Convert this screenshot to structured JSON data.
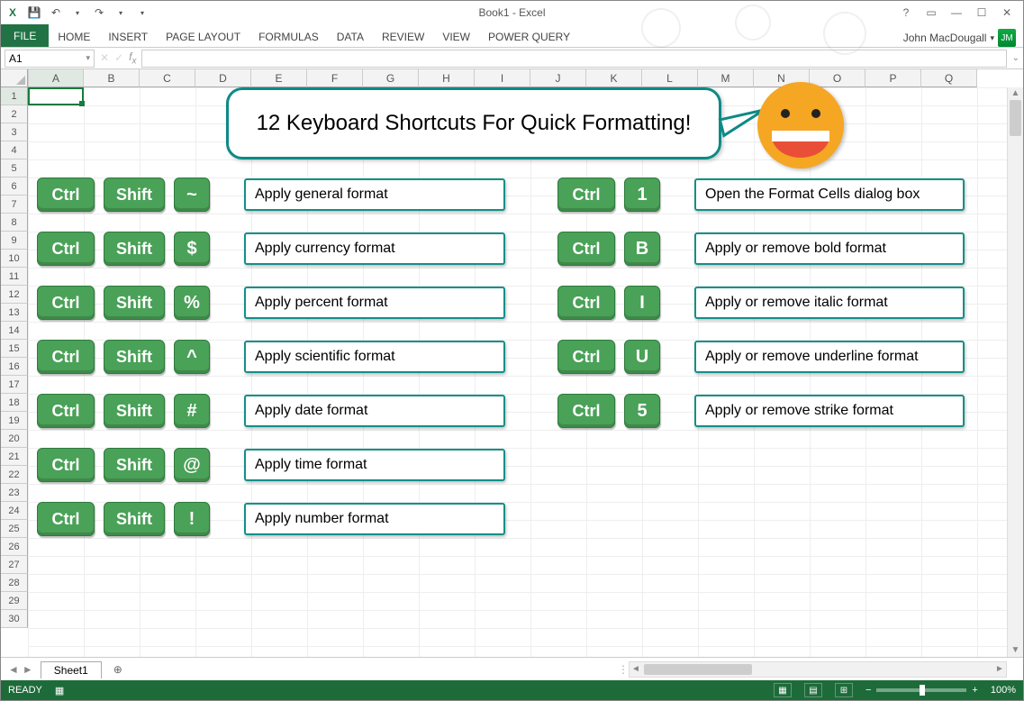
{
  "title": "Book1 - Excel",
  "user": "John MacDougall",
  "ribbon": {
    "file": "FILE",
    "tabs": [
      "HOME",
      "INSERT",
      "PAGE LAYOUT",
      "FORMULAS",
      "DATA",
      "REVIEW",
      "VIEW",
      "POWER QUERY"
    ]
  },
  "namebox": "A1",
  "callout": "12 Keyboard Shortcuts For Quick Formatting!",
  "columns": [
    "A",
    "B",
    "C",
    "D",
    "E",
    "F",
    "G",
    "H",
    "I",
    "J",
    "K",
    "L",
    "M",
    "N",
    "O",
    "P",
    "Q"
  ],
  "rows": [
    "1",
    "2",
    "3",
    "4",
    "5",
    "6",
    "7",
    "8",
    "9",
    "10",
    "11",
    "12",
    "13",
    "14",
    "15",
    "16",
    "17",
    "18",
    "19",
    "20",
    "21",
    "22",
    "23",
    "24",
    "25",
    "26",
    "27",
    "28",
    "29",
    "30"
  ],
  "left": [
    {
      "k1": "Ctrl",
      "k2": "Shift",
      "sym": "~",
      "desc": "Apply general format"
    },
    {
      "k1": "Ctrl",
      "k2": "Shift",
      "sym": "$",
      "desc": "Apply currency format"
    },
    {
      "k1": "Ctrl",
      "k2": "Shift",
      "sym": "%",
      "desc": "Apply percent format"
    },
    {
      "k1": "Ctrl",
      "k2": "Shift",
      "sym": "^",
      "desc": "Apply scientific format"
    },
    {
      "k1": "Ctrl",
      "k2": "Shift",
      "sym": "#",
      "desc": "Apply date format"
    },
    {
      "k1": "Ctrl",
      "k2": "Shift",
      "sym": "@",
      "desc": "Apply time format"
    },
    {
      "k1": "Ctrl",
      "k2": "Shift",
      "sym": "!",
      "desc": "Apply number format"
    }
  ],
  "right": [
    {
      "k1": "Ctrl",
      "sym": "1",
      "desc": "Open the Format Cells dialog box"
    },
    {
      "k1": "Ctrl",
      "sym": "B",
      "desc": "Apply or remove bold format"
    },
    {
      "k1": "Ctrl",
      "sym": "I",
      "desc": "Apply or remove italic format"
    },
    {
      "k1": "Ctrl",
      "sym": "U",
      "desc": "Apply or remove underline format"
    },
    {
      "k1": "Ctrl",
      "sym": "5",
      "desc": "Apply or remove strike format"
    }
  ],
  "sheet": "Sheet1",
  "status": "READY",
  "zoom": "100%"
}
